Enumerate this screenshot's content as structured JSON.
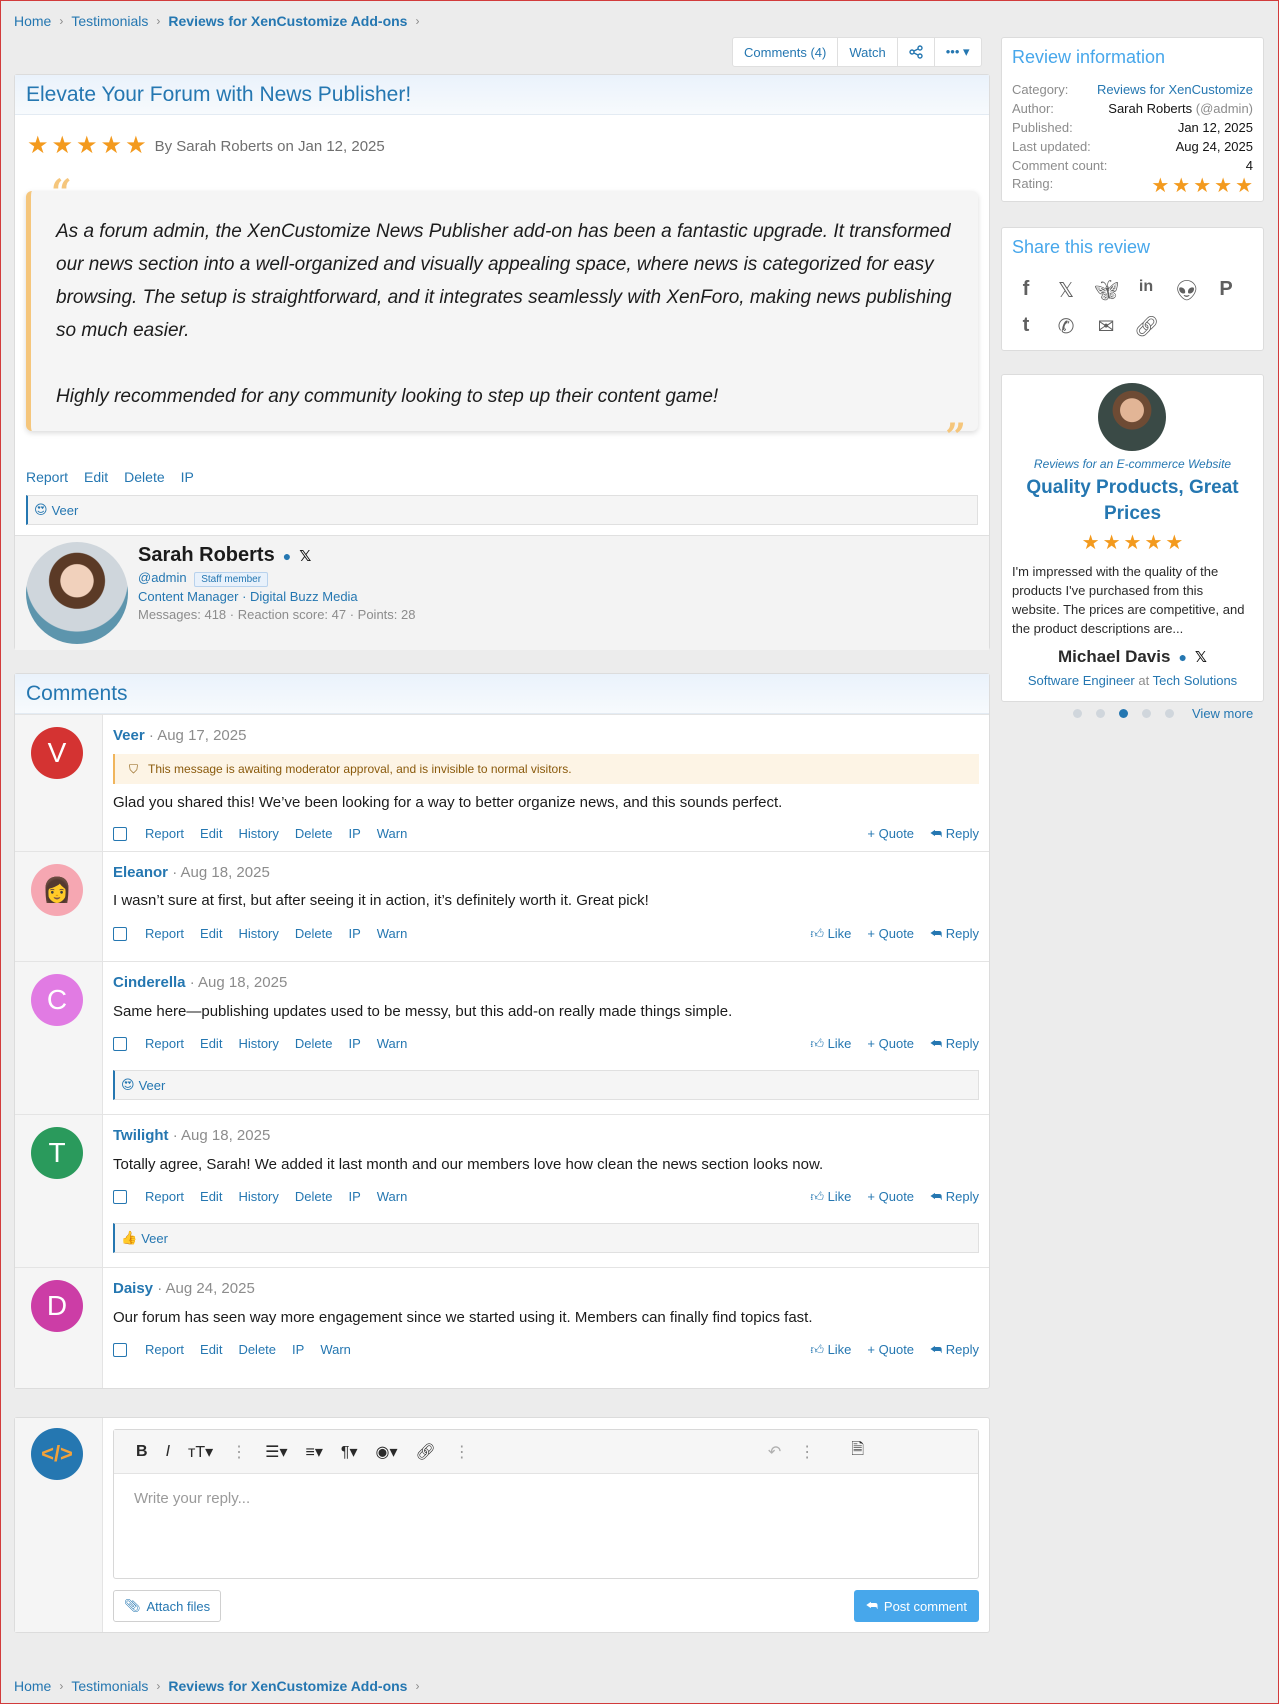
{
  "breadcrumb": {
    "items": [
      "Home",
      "Testimonials"
    ],
    "current": "Reviews for XenCustomize Add-ons"
  },
  "action_bar": {
    "comments": "Comments (4)",
    "watch": "Watch"
  },
  "review": {
    "title": "Elevate Your Forum with News Publisher!",
    "rating": 5,
    "byline": "By Sarah Roberts on Jan 12, 2025",
    "body_p1": "As a forum admin, the XenCustomize News Publisher add-on has been a fantastic upgrade. It transformed our news section into a well-organized and visually appealing space, where news is categorized for easy browsing. The setup is straightforward, and it integrates seamlessly with XenForo, making news publishing so much easier.",
    "body_p2": "Highly recommended for any community looking to step up their content game!",
    "actions": [
      "Report",
      "Edit",
      "Delete",
      "IP"
    ],
    "reaction_user": "Veer"
  },
  "author": {
    "name": "Sarah Roberts",
    "handle": "@admin",
    "badge": "Staff member",
    "role": "Content Manager · Digital Buzz Media",
    "stats": "Messages: 418 · Reaction score: 47 · Points: 28"
  },
  "comments_section": {
    "title": "Comments",
    "comments": [
      {
        "initial": "V",
        "color": "#d43332",
        "name": "Veer",
        "date": "· Aug 17, 2025",
        "notice": "This message is awaiting moderator approval, and is invisible to normal visitors.",
        "text": "Glad you shared this! We’ve been looking for a way to better organize news, and this sounds perfect.",
        "actions": [
          "Report",
          "Edit",
          "History",
          "Delete",
          "IP",
          "Warn"
        ],
        "right": [
          "+ Quote",
          "Reply"
        ]
      },
      {
        "initial": "",
        "color": "#f6a7b2",
        "name": "Eleanor",
        "date": "· Aug 18, 2025",
        "text": "I wasn’t sure at first, but after seeing it in action, it’s definitely worth it. Great pick!",
        "actions": [
          "Report",
          "Edit",
          "History",
          "Delete",
          "IP",
          "Warn"
        ],
        "right": [
          "Like",
          "+ Quote",
          "Reply"
        ]
      },
      {
        "initial": "C",
        "color": "#e17be3",
        "name": "Cinderella",
        "date": "· Aug 18, 2025",
        "text": "Same here—publishing updates used to be messy, but this add-on really made things simple.",
        "actions": [
          "Report",
          "Edit",
          "History",
          "Delete",
          "IP",
          "Warn"
        ],
        "right": [
          "Like",
          "+ Quote",
          "Reply"
        ],
        "reaction_user": "Veer"
      },
      {
        "initial": "T",
        "color": "#2a9a5c",
        "name": "Twilight",
        "date": "· Aug 18, 2025",
        "text": "Totally agree, Sarah! We added it last month and our members love how clean the news section looks now.",
        "actions": [
          "Report",
          "Edit",
          "History",
          "Delete",
          "IP",
          "Warn"
        ],
        "right": [
          "Like",
          "+ Quote",
          "Reply"
        ],
        "reaction_user": "Veer"
      },
      {
        "initial": "D",
        "color": "#cc3da6",
        "name": "Daisy",
        "date": "· Aug 24, 2025",
        "text": "Our forum has seen way more engagement since we started using it. Members can finally find topics fast.",
        "actions": [
          "Report",
          "Edit",
          "Delete",
          "IP",
          "Warn"
        ],
        "right": [
          "Like",
          "+ Quote",
          "Reply"
        ]
      }
    ]
  },
  "editor": {
    "placeholder": "Write your reply...",
    "attach": "Attach files",
    "post": "Post comment"
  },
  "review_info": {
    "title": "Review information",
    "rows": [
      {
        "k": "Category:",
        "v": "Reviews for XenCustomize"
      },
      {
        "k": "Author:",
        "v": "Sarah Roberts",
        "v2": "(@admin)"
      },
      {
        "k": "Published:",
        "v": "Jan 12, 2025"
      },
      {
        "k": "Last updated:",
        "v": "Aug 24, 2025"
      },
      {
        "k": "Comment count:",
        "v": "4"
      },
      {
        "k": "Rating:",
        "v": ""
      }
    ],
    "rating": 5
  },
  "share": {
    "title": "Share this review",
    "icons": [
      "facebook-icon",
      "x-icon",
      "bluesky-icon",
      "linkedin-icon",
      "reddit-icon",
      "pinterest-icon",
      "tumblr-icon",
      "whatsapp-icon",
      "email-icon",
      "link-icon"
    ]
  },
  "testimonial": {
    "subtitle": "Reviews for an E-commerce Website",
    "title": "Quality Products, Great Prices",
    "rating": 5,
    "text": "I'm impressed with the quality of the products I've purchased from this website. The prices are competitive, and the product descriptions are...",
    "name": "Michael Davis",
    "role": "Software Engineer",
    "at": "at",
    "company": "Tech Solutions"
  },
  "carousel": {
    "active_index": 2,
    "count": 5,
    "view_more": "View more"
  },
  "colors": {
    "accent": "#2577b1",
    "star": "#f39a1e",
    "button": "#47a7eb"
  }
}
